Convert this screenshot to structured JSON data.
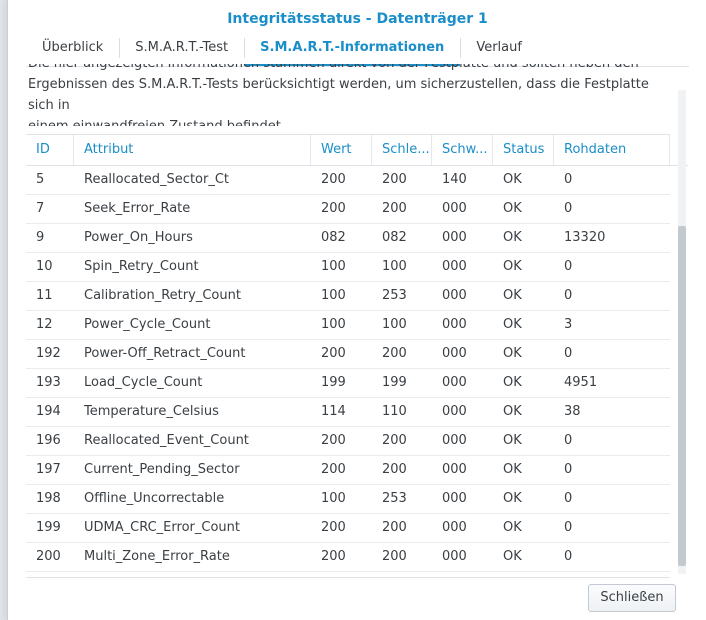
{
  "window": {
    "title": "Integritätsstatus - Datenträger 1"
  },
  "tabs": [
    {
      "label": "Überblick"
    },
    {
      "label": "S.M.A.R.T.-Test"
    },
    {
      "label": "S.M.A.R.T.-Informationen",
      "active": true
    },
    {
      "label": "Verlauf"
    }
  ],
  "description": {
    "line1": "Die hier angezeigten Informationen stammen direkt von der Festplatte und sollten neben den",
    "line2": "Ergebnissen des S.M.A.R.T.-Tests berücksichtigt werden, um sicherzustellen, dass die Festplatte sich in",
    "line3": "einem einwandfreien Zustand befindet."
  },
  "table": {
    "columns": [
      "ID",
      "Attribut",
      "Wert",
      "Schle...",
      "Schw...",
      "Status",
      "Rohdaten"
    ],
    "rows": [
      [
        "5",
        "Reallocated_Sector_Ct",
        "200",
        "200",
        "140",
        "OK",
        "0"
      ],
      [
        "7",
        "Seek_Error_Rate",
        "200",
        "200",
        "000",
        "OK",
        "0"
      ],
      [
        "9",
        "Power_On_Hours",
        "082",
        "082",
        "000",
        "OK",
        "13320"
      ],
      [
        "10",
        "Spin_Retry_Count",
        "100",
        "100",
        "000",
        "OK",
        "0"
      ],
      [
        "11",
        "Calibration_Retry_Count",
        "100",
        "253",
        "000",
        "OK",
        "0"
      ],
      [
        "12",
        "Power_Cycle_Count",
        "100",
        "100",
        "000",
        "OK",
        "3"
      ],
      [
        "192",
        "Power-Off_Retract_Count",
        "200",
        "200",
        "000",
        "OK",
        "0"
      ],
      [
        "193",
        "Load_Cycle_Count",
        "199",
        "199",
        "000",
        "OK",
        "4951"
      ],
      [
        "194",
        "Temperature_Celsius",
        "114",
        "110",
        "000",
        "OK",
        "38"
      ],
      [
        "196",
        "Reallocated_Event_Count",
        "200",
        "200",
        "000",
        "OK",
        "0"
      ],
      [
        "197",
        "Current_Pending_Sector",
        "200",
        "200",
        "000",
        "OK",
        "0"
      ],
      [
        "198",
        "Offline_Uncorrectable",
        "100",
        "253",
        "000",
        "OK",
        "0"
      ],
      [
        "199",
        "UDMA_CRC_Error_Count",
        "200",
        "200",
        "000",
        "OK",
        "0"
      ],
      [
        "200",
        "Multi_Zone_Error_Rate",
        "200",
        "200",
        "000",
        "OK",
        "0"
      ]
    ]
  },
  "buttons": {
    "close": "Schließen"
  },
  "colors": {
    "accent": "#1a8ec9",
    "text": "#3a3f44"
  }
}
